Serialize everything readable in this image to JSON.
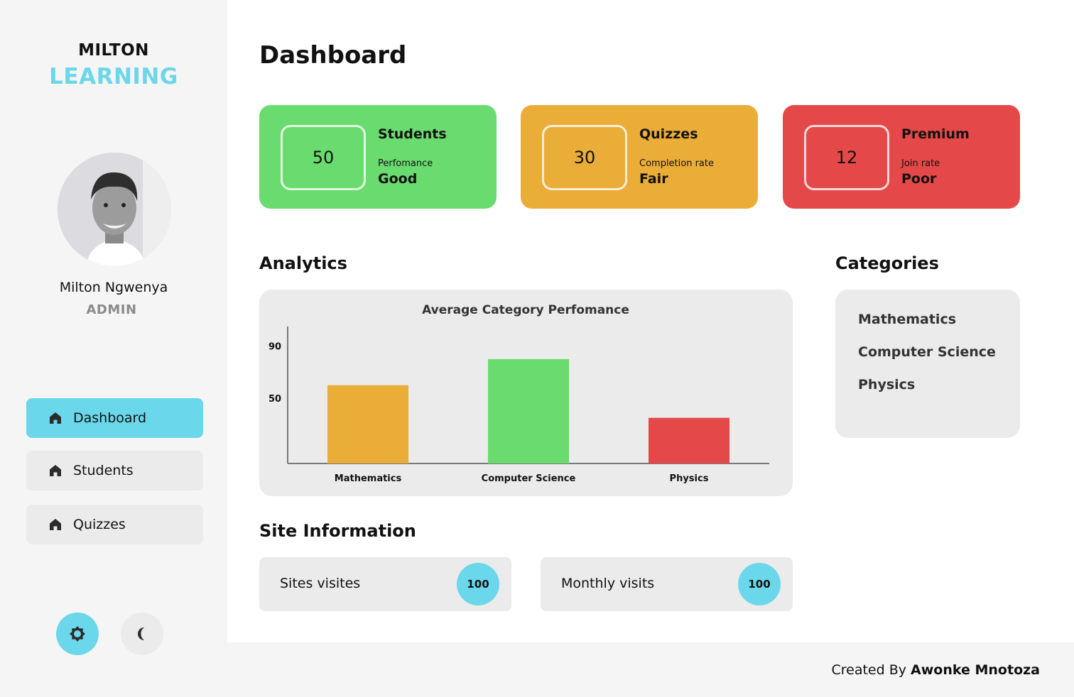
{
  "brand": {
    "line1": "MILTON",
    "line2": "LEARNING",
    "accent_color": "#6cd6ea"
  },
  "user": {
    "name": "Milton Ngwenya",
    "role": "ADMIN",
    "avatar": "profile-photo"
  },
  "nav": {
    "items": [
      {
        "label": "Dashboard",
        "icon": "home-icon",
        "active": true
      },
      {
        "label": "Students",
        "icon": "home-icon",
        "active": false
      },
      {
        "label": "Quizzes",
        "icon": "home-icon",
        "active": false
      }
    ]
  },
  "theme_toggle": {
    "light_icon": "sun-icon",
    "dark_icon": "moon-icon",
    "selected": "light"
  },
  "page": {
    "title": "Dashboard"
  },
  "stats": [
    {
      "value": "50",
      "title": "Students",
      "sub": "Perfomance",
      "rating": "Good",
      "color": "#6adb6e"
    },
    {
      "value": "30",
      "title": "Quizzes",
      "sub": "Completion rate",
      "rating": "Fair",
      "color": "#eaad38"
    },
    {
      "value": "12",
      "title": "Premium",
      "sub": "Join rate",
      "rating": "Poor",
      "color": "#e54848"
    }
  ],
  "analytics": {
    "title": "Analytics"
  },
  "chart_data": {
    "type": "bar",
    "title": "Average Category Perfomance",
    "categories": [
      "Mathematics",
      "Computer Science",
      "Physics"
    ],
    "values": [
      60,
      80,
      35
    ],
    "colors": [
      "#eaad38",
      "#6adb6e",
      "#e54848"
    ],
    "yticks": [
      50,
      90
    ],
    "ylim": [
      0,
      105
    ],
    "grid": false,
    "xlabel": "",
    "ylabel": ""
  },
  "categories": {
    "title": "Categories",
    "items": [
      "Mathematics",
      "Computer Science",
      "Physics"
    ]
  },
  "site_info": {
    "title": "Site Information",
    "cards": [
      {
        "label": "Sites visites",
        "value": "100"
      },
      {
        "label": "Monthly visits",
        "value": "100"
      }
    ]
  },
  "footer": {
    "prefix": "Created By",
    "author": "Awonke Mnotoza"
  }
}
